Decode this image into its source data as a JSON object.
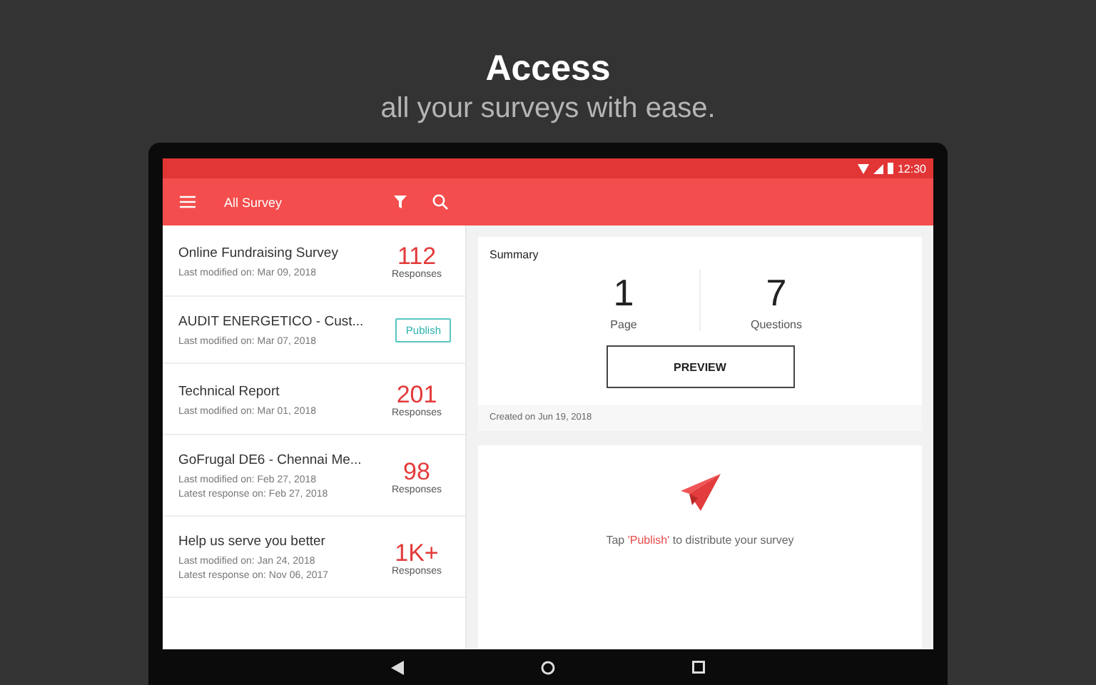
{
  "headline": {
    "title": "Access",
    "subtitle": "all your surveys with ease."
  },
  "status_bar": {
    "time": "12:30"
  },
  "app_bar": {
    "title": "All Survey"
  },
  "surveys": [
    {
      "kind": "responses",
      "title": "Online Fundraising Survey",
      "lines": [
        "Last modified on: Mar 09, 2018"
      ],
      "count": "112",
      "count_label": "Responses"
    },
    {
      "kind": "publish",
      "title": "AUDIT ENERGETICO - Cust...",
      "lines": [
        "Last modified on: Mar 07, 2018"
      ],
      "action": "Publish"
    },
    {
      "kind": "responses",
      "title": "Technical Report",
      "lines": [
        "Last modified on: Mar 01, 2018"
      ],
      "count": "201",
      "count_label": "Responses"
    },
    {
      "kind": "responses",
      "title": "GoFrugal DE6 - Chennai Me...",
      "lines": [
        "Last modified on: Feb 27, 2018",
        "Latest response on:  Feb 27, 2018"
      ],
      "count": "98",
      "count_label": "Responses"
    },
    {
      "kind": "responses",
      "title": "Help us serve you better",
      "lines": [
        "Last modified on: Jan 24, 2018",
        "Latest response on:  Nov 06, 2017"
      ],
      "count": "1K+",
      "count_label": "Responses"
    }
  ],
  "summary": {
    "title": "Summary",
    "stats": [
      {
        "value": "1",
        "label": "Page"
      },
      {
        "value": "7",
        "label": "Questions"
      }
    ],
    "button": "PREVIEW",
    "created": "Created on Jun 19, 2018"
  },
  "publish_hint": {
    "before": "Tap ",
    "highlight": "'Publish'",
    "after": " to distribute your survey"
  }
}
